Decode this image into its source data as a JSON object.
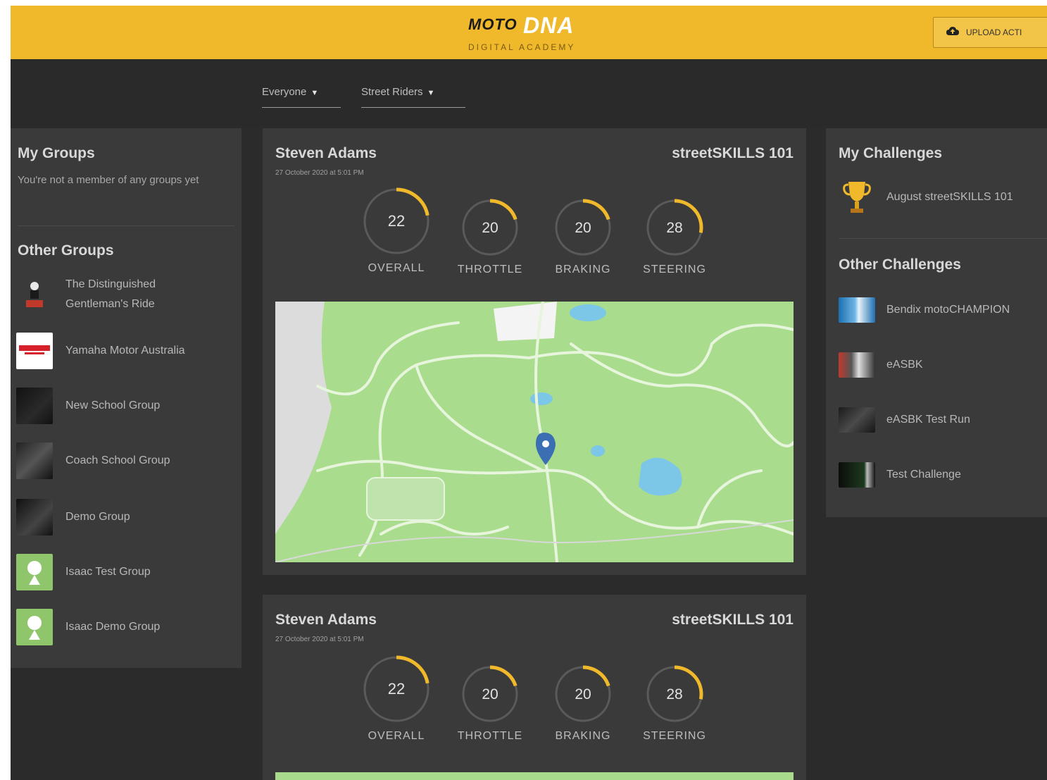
{
  "header": {
    "logo_moto": "MOTO",
    "logo_dna": "DNA",
    "logo_academy": "DIGITAL ACADEMY",
    "upload_label": "UPLOAD ACTI",
    "brand_color": "#f0b92b"
  },
  "filters": {
    "audience": "Everyone",
    "category": "Street Riders"
  },
  "groups": {
    "my_title": "My Groups",
    "my_empty": "You're not a member of any groups yet",
    "other_title": "Other Groups",
    "items": [
      {
        "label": "The Distinguished Gentleman's Ride",
        "icon": "dgr-logo"
      },
      {
        "label": "Yamaha Motor Australia",
        "icon": "yamaha-logo"
      },
      {
        "label": "New School Group",
        "icon": "group-photo"
      },
      {
        "label": "Coach School Group",
        "icon": "group-photo"
      },
      {
        "label": "Demo Group",
        "icon": "group-photo"
      },
      {
        "label": "Isaac Test Group",
        "icon": "map-pin-thumb"
      },
      {
        "label": "Isaac Demo Group",
        "icon": "map-pin-thumb"
      }
    ]
  },
  "feed": [
    {
      "rider": "Steven Adams",
      "date": "27 October 2020 at 5:01 PM",
      "course": "streetSKILLS 101",
      "scores": [
        {
          "label": "OVERALL",
          "value": "22",
          "fraction": 0.22
        },
        {
          "label": "THROTTLE",
          "value": "20",
          "fraction": 0.2
        },
        {
          "label": "BRAKING",
          "value": "20",
          "fraction": 0.2
        },
        {
          "label": "STEERING",
          "value": "28",
          "fraction": 0.28
        }
      ]
    },
    {
      "rider": "Steven Adams",
      "date": "27 October 2020 at 5:01 PM",
      "course": "streetSKILLS 101",
      "scores": [
        {
          "label": "OVERALL",
          "value": "22",
          "fraction": 0.22
        },
        {
          "label": "THROTTLE",
          "value": "20",
          "fraction": 0.2
        },
        {
          "label": "BRAKING",
          "value": "20",
          "fraction": 0.2
        },
        {
          "label": "STEERING",
          "value": "28",
          "fraction": 0.28
        }
      ]
    }
  ],
  "challenges": {
    "my_title": "My Challenges",
    "my_items": [
      {
        "label": "August streetSKILLS 101",
        "icon": "trophy-icon"
      }
    ],
    "other_title": "Other Challenges",
    "other_items": [
      {
        "label": "Bendix motoCHAMPION",
        "icon": "challenge-thumb"
      },
      {
        "label": "eASBK",
        "icon": "challenge-thumb"
      },
      {
        "label": "eASBK Test Run",
        "icon": "challenge-thumb"
      },
      {
        "label": "Test Challenge",
        "icon": "challenge-thumb"
      }
    ]
  }
}
